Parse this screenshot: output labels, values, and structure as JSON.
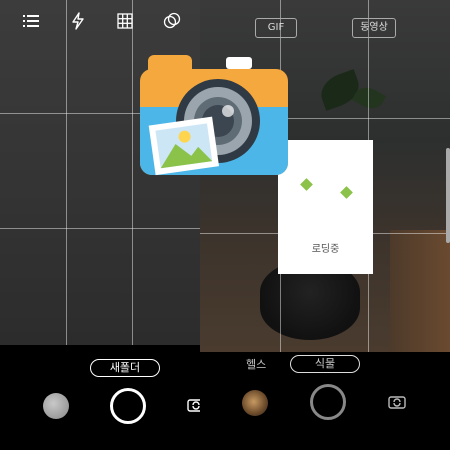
{
  "left_camera": {
    "top_icons": [
      "menu-icon",
      "flash-icon",
      "grid-icon",
      "filter-icon"
    ],
    "folder_button": "새폴더"
  },
  "right_camera": {
    "gif_label": "GIF",
    "video_label": "동영상",
    "modes": [
      "헬스",
      "식물"
    ],
    "selected_mode": "식물"
  },
  "loading_dialog": {
    "text": "로딩중"
  },
  "colors": {
    "accent": "#8bc34a",
    "icon_orange": "#f5a83d",
    "icon_blue": "#4db6e8"
  }
}
